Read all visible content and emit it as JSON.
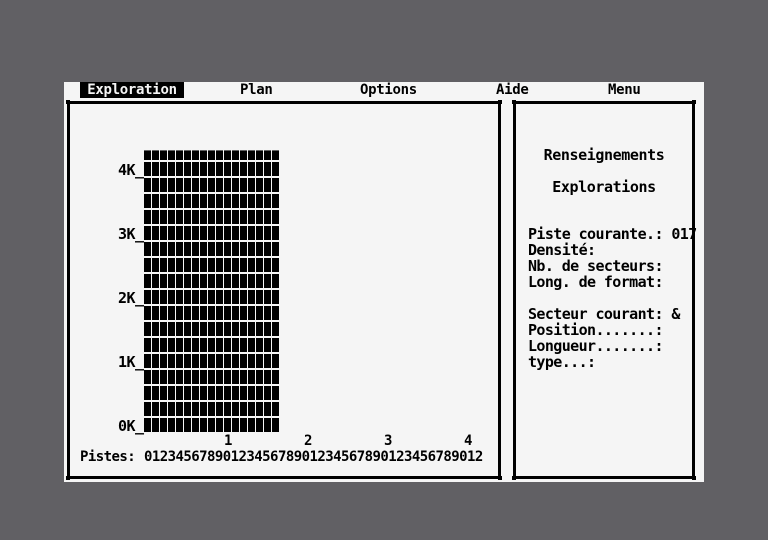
{
  "menu": {
    "items": [
      {
        "id": "exploration",
        "label": "Exploration",
        "active": true
      },
      {
        "id": "plan",
        "label": "Plan",
        "active": false
      },
      {
        "id": "options",
        "label": "Options",
        "active": false
      },
      {
        "id": "aide",
        "label": "Aide",
        "active": false
      },
      {
        "id": "menu",
        "label": "Menu",
        "active": false
      }
    ]
  },
  "chart_data": {
    "type": "bar",
    "y_ticks": [
      "4K_",
      "3K_",
      "2K_",
      "1K_",
      "0K_"
    ],
    "ylim": [
      0,
      4.5
    ],
    "y_unit": "K",
    "x_tens": [
      "1",
      "2",
      "3",
      "4"
    ],
    "x_prefix": "Pistes: ",
    "x_digits": "0123456789012345678901234567890123456789012",
    "bar_color": "#000000",
    "values": [
      4.4,
      4.4,
      4.4,
      4.4,
      4.4,
      4.4,
      4.4,
      4.4,
      4.4,
      4.4,
      4.4,
      4.4,
      4.4,
      4.4,
      4.4,
      4.4,
      4.4,
      0,
      0,
      0,
      0,
      0,
      0,
      0,
      0,
      0,
      0,
      0,
      0,
      0,
      0,
      0,
      0,
      0,
      0,
      0,
      0,
      0,
      0,
      0,
      0,
      0,
      0
    ]
  },
  "info": {
    "title": "Renseignements",
    "subtitle": "Explorations",
    "lines": [
      "Piste courante.: 017",
      "Densité:",
      "Nb. de secteurs:",
      "Long. de format:",
      "",
      "Secteur courant: &",
      "Position.......:",
      "Longueur.......:",
      "type...:"
    ]
  }
}
